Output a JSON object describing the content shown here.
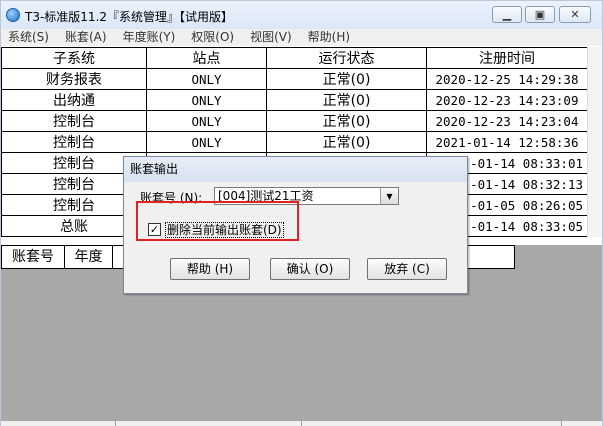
{
  "window": {
    "title": "T3-标准版11.2『系统管理』【试用版】",
    "min_glyph": "▁",
    "max_glyph": "▣",
    "close_glyph": "✕"
  },
  "menu": {
    "items": [
      {
        "label": "系统(S)"
      },
      {
        "label": "账套(A)"
      },
      {
        "label": "年度账(Y)"
      },
      {
        "label": "权限(O)"
      },
      {
        "label": "视图(V)"
      },
      {
        "label": "帮助(H)"
      }
    ]
  },
  "top_table": {
    "headers": [
      "子系统",
      "站点",
      "运行状态",
      "注册时间"
    ],
    "rows": [
      [
        "财务报表",
        "ONLY",
        "正常(0)",
        "2020-12-25 14:29:38"
      ],
      [
        "出纳通",
        "ONLY",
        "正常(0)",
        "2020-12-23 14:23:09"
      ],
      [
        "控制台",
        "ONLY",
        "正常(0)",
        "2020-12-23 14:23:04"
      ],
      [
        "控制台",
        "ONLY",
        "正常(0)",
        "2021-01-14 12:58:36"
      ],
      [
        "控制台",
        "",
        "",
        "-01-14 08:33:01"
      ],
      [
        "控制台",
        "",
        "",
        "-01-14 08:32:13"
      ],
      [
        "控制台",
        "",
        "",
        "-01-05 08:26:05"
      ],
      [
        "总账",
        "",
        "",
        "-01-14 08:33:05"
      ]
    ]
  },
  "bottom_table": {
    "headers": [
      "账套号",
      "年度",
      ""
    ]
  },
  "dialog": {
    "title": "账套输出",
    "account_label": "账套号 (N):",
    "account_value": "[004]测试21工资",
    "dropdown_glyph": "▼",
    "checkbox_checked": true,
    "checkbox_glyph": "✓",
    "checkbox_label": "删除当前输出账套(D)",
    "help_button": "帮助 (H)",
    "ok_button": "确认 (O)",
    "cancel_button": "放弃 (C)"
  },
  "colors": {
    "highlight_box": "#e02222",
    "bottom_area": "#a8a8a8"
  }
}
